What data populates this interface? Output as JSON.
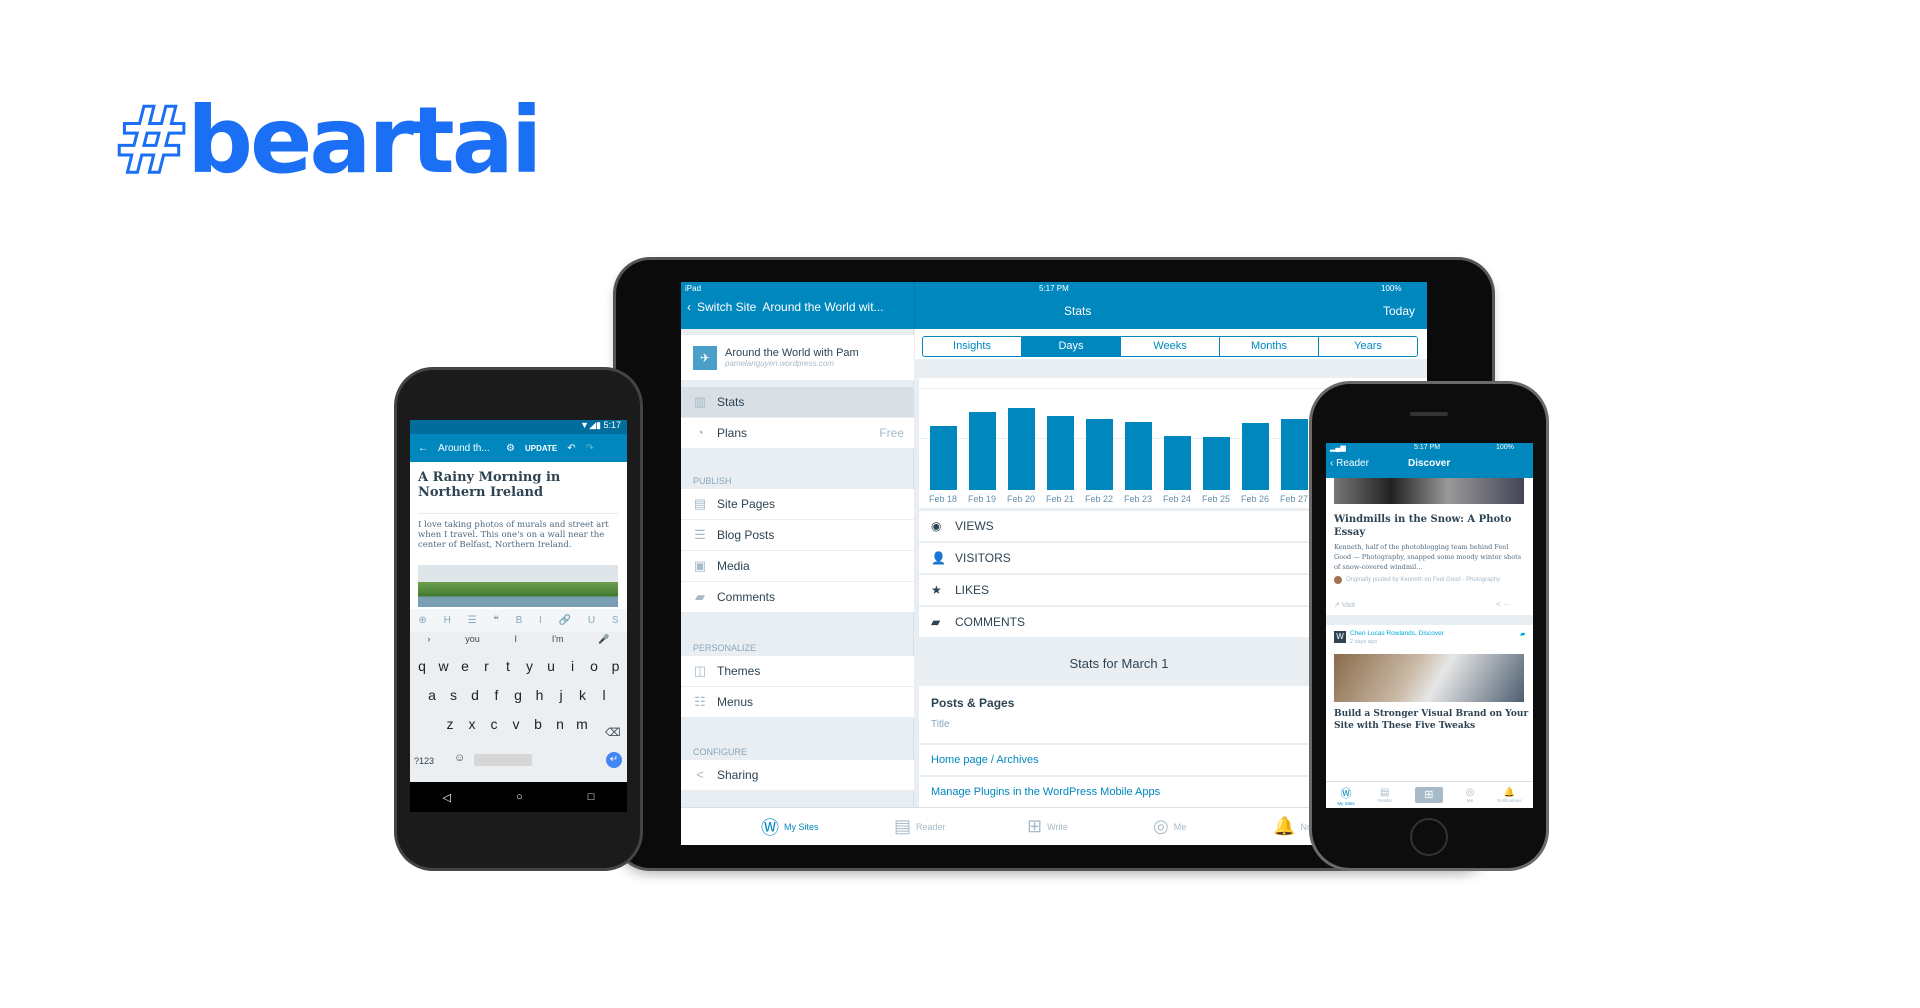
{
  "brand": {
    "logo": "#beartai",
    "color": "#1a6ff5"
  },
  "tablet": {
    "status": {
      "left": "iPad",
      "time": "5:17 PM",
      "battery": "100%"
    },
    "sidebar": {
      "back_label": "Switch Site",
      "site_title_short": "Around the World wit...",
      "site_name": "Around the World with Pam",
      "site_url": "pamelanguyen.wordpress.com",
      "items_top": [
        {
          "label": "Stats",
          "icon": "stats-icon",
          "selected": true
        },
        {
          "label": "Plans",
          "icon": "plans-icon",
          "badge": "Free"
        }
      ],
      "sections": [
        {
          "title": "PUBLISH",
          "items": [
            {
              "label": "Site Pages",
              "icon": "pages-icon"
            },
            {
              "label": "Blog Posts",
              "icon": "posts-icon"
            },
            {
              "label": "Media",
              "icon": "media-icon"
            },
            {
              "label": "Comments",
              "icon": "comments-icon"
            }
          ]
        },
        {
          "title": "PERSONALIZE",
          "items": [
            {
              "label": "Themes",
              "icon": "themes-icon"
            },
            {
              "label": "Menus",
              "icon": "menus-icon"
            }
          ]
        },
        {
          "title": "CONFIGURE",
          "items": [
            {
              "label": "Sharing",
              "icon": "share-icon"
            }
          ]
        }
      ]
    },
    "main": {
      "title": "Stats",
      "right_action": "Today",
      "periods": [
        {
          "label": "Insights"
        },
        {
          "label": "Days",
          "active": true
        },
        {
          "label": "Weeks"
        },
        {
          "label": "Months"
        },
        {
          "label": "Years"
        }
      ],
      "metrics": [
        {
          "label": "VIEWS",
          "icon": "eye-icon"
        },
        {
          "label": "VISITORS",
          "icon": "person-icon"
        },
        {
          "label": "LIKES",
          "icon": "star-icon"
        },
        {
          "label": "COMMENTS",
          "icon": "comment-icon"
        }
      ],
      "stats_for": "Stats for March 1",
      "posts_pages": {
        "title": "Posts & Pages",
        "column": "Title",
        "rows": [
          "Home page / Archives",
          "Manage Plugins in the WordPress Mobile Apps"
        ]
      }
    },
    "tabbar": [
      {
        "label": "My Sites",
        "icon": "wordpress-icon",
        "active": true
      },
      {
        "label": "Reader",
        "icon": "reader-icon"
      },
      {
        "label": "Write",
        "icon": "write-icon"
      },
      {
        "label": "Me",
        "icon": "me-icon"
      },
      {
        "label": "Notifications",
        "icon": "bell-icon"
      }
    ]
  },
  "chart_data": {
    "type": "bar",
    "categories": [
      "Feb 18",
      "Feb 19",
      "Feb 20",
      "Feb 21",
      "Feb 22",
      "Feb 23",
      "Feb 24",
      "Feb 25",
      "Feb 26",
      "Feb 27"
    ],
    "values": [
      191,
      234,
      245,
      221,
      212,
      204,
      162,
      158,
      201,
      212
    ],
    "color": "#0087be",
    "grid": true
  },
  "android": {
    "time": "5:17",
    "toolbar": {
      "title": "Around th...",
      "update": "UPDATE"
    },
    "post_title": "A Rainy Morning in Northern Ireland",
    "post_body": "I love taking photos of murals and street art when I travel. This one's on a wall near the center of Belfast, Northern Ireland.",
    "format_bar": [
      "⊕",
      "H",
      "☰",
      "❝",
      "B",
      "I",
      "🔗",
      "U",
      "S"
    ],
    "suggestions": [
      "you",
      "I",
      "I'm"
    ],
    "keys": {
      "row1": [
        "q",
        "w",
        "e",
        "r",
        "t",
        "y",
        "u",
        "i",
        "o",
        "p"
      ],
      "row2": [
        "a",
        "s",
        "d",
        "f",
        "g",
        "h",
        "j",
        "k",
        "l"
      ],
      "row3": [
        "z",
        "x",
        "c",
        "v",
        "b",
        "n",
        "m"
      ],
      "num": "?123"
    }
  },
  "iphone": {
    "status": {
      "time": "5:17 PM",
      "battery": "100%"
    },
    "nav": {
      "back": "Reader",
      "title": "Discover"
    },
    "card1": {
      "title": "Windmills in the Snow: A Photo Essay",
      "excerpt": "Kenneth, half of the photoblogging team behind Feel Good — Photography, snapped some moody winter shots of snow-covered windmil...",
      "attribution": "Originally posted by Kenneth on Feel Good - Photography",
      "visit": "Visit"
    },
    "card2": {
      "author": "Cheri Lucas Rowlands, Discover",
      "time": "2 days ago",
      "title": "Build a Stronger Visual Brand on Your Site with These Five Tweaks"
    },
    "tabbar": [
      "My Sites",
      "Reader",
      "",
      "Me",
      "Notifications"
    ]
  }
}
